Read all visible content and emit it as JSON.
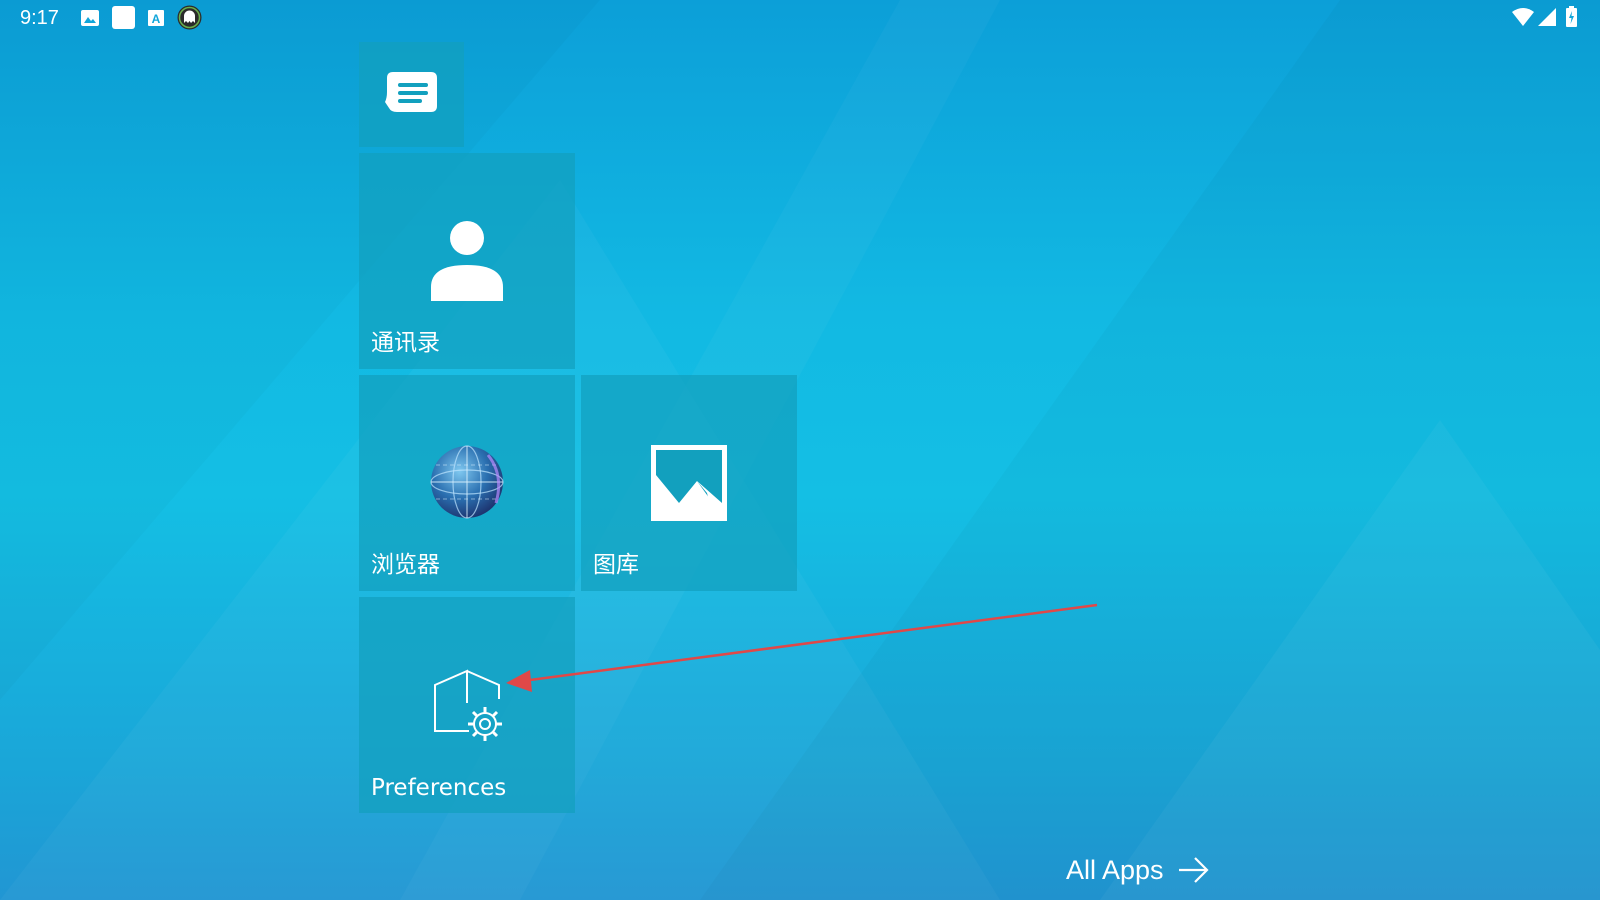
{
  "status_bar": {
    "time": "9:17",
    "left_icons": [
      "image-icon",
      "white-square-icon",
      "font-a-icon",
      "ghost-app-icon"
    ],
    "right_icons": [
      "wifi-icon",
      "signal-icon",
      "battery-charging-icon"
    ]
  },
  "tiles": {
    "messages": {
      "label": "",
      "icon": "message-icon"
    },
    "contacts": {
      "label": "通讯录",
      "icon": "person-icon"
    },
    "browser": {
      "label": "浏览器",
      "icon": "globe-icon"
    },
    "gallery": {
      "label": "图库",
      "icon": "picture-icon"
    },
    "preferences": {
      "label": "Preferences",
      "icon": "home-settings-icon"
    }
  },
  "all_apps": {
    "label": "All Apps",
    "icon": "arrow-right-icon"
  },
  "colors": {
    "background_top": "#0c9fd8",
    "background_mid": "#14bfe4",
    "tile": "#12a0be",
    "annotation_arrow": "#e04848"
  }
}
